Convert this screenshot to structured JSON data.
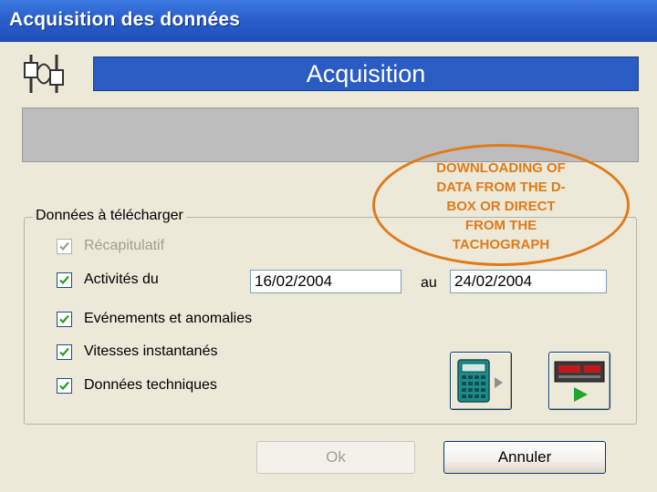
{
  "window": {
    "title": "Acquisition des données"
  },
  "header": {
    "banner": "Acquisition"
  },
  "group": {
    "label": "Données à télécharger",
    "options": [
      {
        "label": "Récapitulatif",
        "checked": true,
        "disabled": true
      },
      {
        "label": "Activités du",
        "checked": true,
        "disabled": false
      },
      {
        "label": "Evénements et anomalies",
        "checked": true,
        "disabled": false
      },
      {
        "label": "Vitesses instantanés",
        "checked": true,
        "disabled": false
      },
      {
        "label": "Données techniques",
        "checked": true,
        "disabled": false
      }
    ],
    "date_from": "16/02/2004",
    "date_to_label": "au",
    "date_to": "24/02/2004"
  },
  "source_buttons": [
    {
      "icon": "calculator-dbox-icon"
    },
    {
      "icon": "tachograph-icon"
    }
  ],
  "buttons": {
    "ok": "Ok",
    "cancel": "Annuler"
  },
  "annotation": {
    "text": "DOWNLOADING OF\nDATA FROM THE D-\nBOX OR DIRECT\nFROM THE\nTACHOGRAPH"
  },
  "colors": {
    "titlebar": "#2a5fcc",
    "banner": "#2a5cc4",
    "annotation": "#e07b1a"
  }
}
